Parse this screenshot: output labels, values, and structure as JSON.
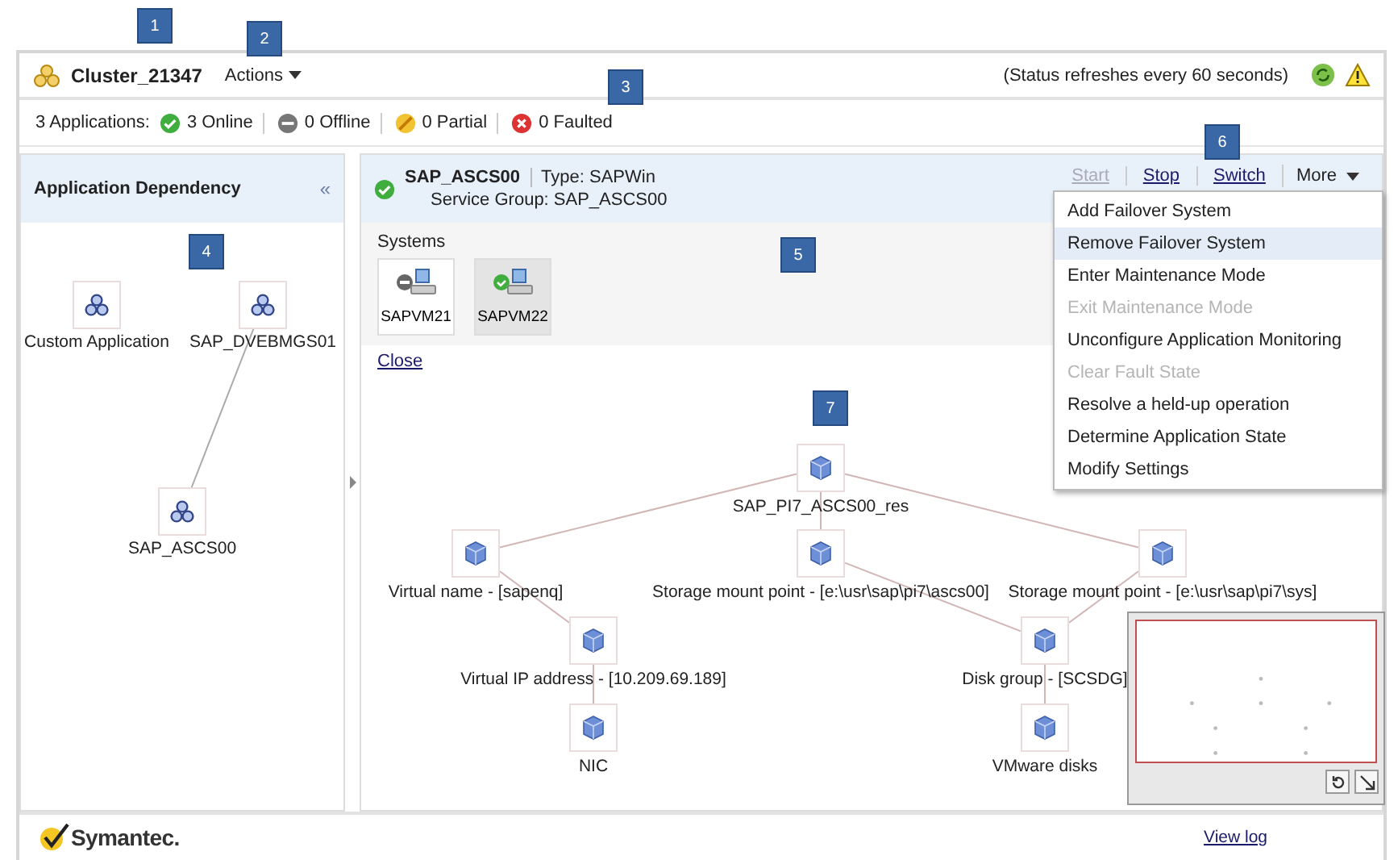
{
  "callouts": [
    {
      "label": "1"
    },
    {
      "label": "2"
    },
    {
      "label": "3"
    },
    {
      "label": "4"
    },
    {
      "label": "5"
    },
    {
      "label": "6"
    },
    {
      "label": "7"
    }
  ],
  "header": {
    "cluster": "Cluster_21347",
    "actions": "Actions",
    "status_note": "(Status refreshes every 60 seconds)"
  },
  "summary": {
    "label": "3 Applications:",
    "items": [
      {
        "kind": "online",
        "text": "3 Online"
      },
      {
        "kind": "offline",
        "text": "0 Offline"
      },
      {
        "kind": "partial",
        "text": "0 Partial"
      },
      {
        "kind": "faulted",
        "text": "0 Faulted"
      }
    ]
  },
  "sidebar": {
    "title": "Application Dependency",
    "collapse": "«",
    "nodes": [
      {
        "label": "Custom Application"
      },
      {
        "label": "SAP_DVEBMGS01"
      },
      {
        "label": "SAP_ASCS00"
      }
    ]
  },
  "app": {
    "kind": "online",
    "name": "SAP_ASCS00",
    "type": "Type: SAPWin",
    "service_group": "Service Group:  SAP_ASCS00",
    "actions": [
      {
        "label": "Start",
        "disabled": true
      },
      {
        "label": "Stop",
        "disabled": false
      },
      {
        "label": "Switch",
        "disabled": false
      }
    ],
    "more": "More",
    "menu": [
      {
        "label": "Add Failover System",
        "disabled": false,
        "selected": false
      },
      {
        "label": "Remove Failover System",
        "disabled": false,
        "selected": true
      },
      {
        "label": "Enter Maintenance Mode",
        "disabled": false,
        "selected": false
      },
      {
        "label": "Exit Maintenance Mode",
        "disabled": true,
        "selected": false
      },
      {
        "label": "Unconfigure Application Monitoring",
        "disabled": false,
        "selected": false
      },
      {
        "label": "Clear Fault State",
        "disabled": true,
        "selected": false
      },
      {
        "label": "Resolve a held-up operation",
        "disabled": false,
        "selected": false
      },
      {
        "label": "Determine Application State",
        "disabled": false,
        "selected": false
      },
      {
        "label": "Modify Settings",
        "disabled": false,
        "selected": false
      }
    ]
  },
  "systems": {
    "title": "Systems",
    "items": [
      {
        "name": "SAPVM21",
        "kind": "offline",
        "selected": false
      },
      {
        "name": "SAPVM22",
        "kind": "online",
        "selected": true
      }
    ]
  },
  "close": "Close",
  "graph_nodes": [
    {
      "label": "SAP_PI7_ASCS00_res"
    },
    {
      "label": "Virtual name - [sapenq]"
    },
    {
      "label": "Storage mount point - [e:\\usr\\sap\\pi7\\ascs00]"
    },
    {
      "label": "Storage mount point - [e:\\usr\\sap\\pi7\\sys]"
    },
    {
      "label": "Virtual IP address - [10.209.69.189]"
    },
    {
      "label": "Disk group - [SCSDG]"
    },
    {
      "label": "NIC"
    },
    {
      "label": "VMware disks"
    }
  ],
  "footer": {
    "logo": "Symantec.",
    "view_log": "View log"
  }
}
